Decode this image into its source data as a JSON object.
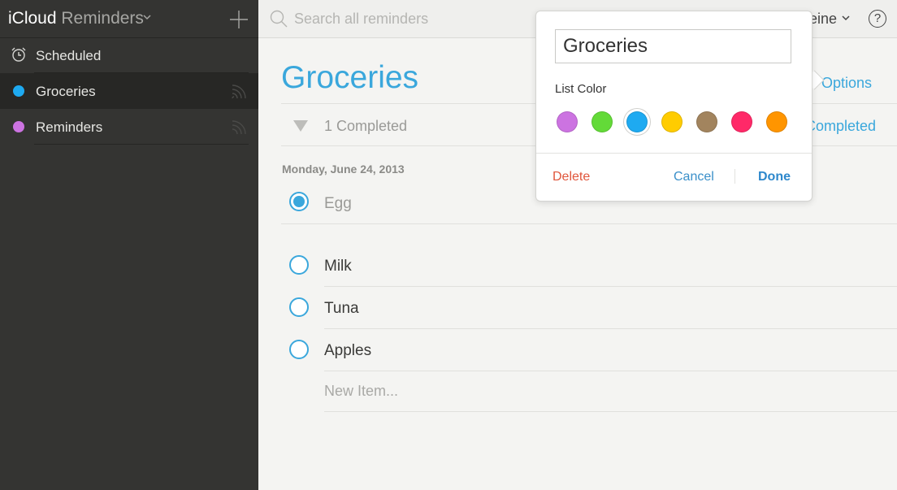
{
  "app": {
    "brand": "iCloud",
    "name": "Reminders"
  },
  "sidebar": {
    "items": [
      {
        "label": "Scheduled"
      },
      {
        "label": "Groceries",
        "color": "#1eaaf1"
      },
      {
        "label": "Reminders",
        "color": "#cc73e1"
      }
    ]
  },
  "topbar": {
    "search_placeholder": "Search all reminders",
    "user_name": "eine",
    "help_label": "?"
  },
  "main": {
    "list_title": "Groceries",
    "options_label": "Options",
    "completed_count": "1 Completed",
    "show_completed_label": "Show Completed",
    "date_heading": "Monday, June 24, 2013",
    "completed_items": [
      {
        "text": "Egg"
      }
    ],
    "items": [
      {
        "text": "Milk"
      },
      {
        "text": "Tuna"
      },
      {
        "text": "Apples"
      }
    ],
    "new_item_placeholder": "New Item..."
  },
  "popover": {
    "name_value": "Groceries",
    "color_label": "List Color",
    "colors": [
      "#cc73e1",
      "#63da38",
      "#1eaaf1",
      "#ffcc00",
      "#a2845e",
      "#ff2968",
      "#ff9500"
    ],
    "selected_color_index": 2,
    "delete_label": "Delete",
    "cancel_label": "Cancel",
    "done_label": "Done"
  },
  "icons": {
    "alarm": "alarm-clock-icon",
    "share": "shared-list-icon",
    "search": "search-icon",
    "add": "plus-icon",
    "disclosure": "disclosure-triangle-icon"
  }
}
